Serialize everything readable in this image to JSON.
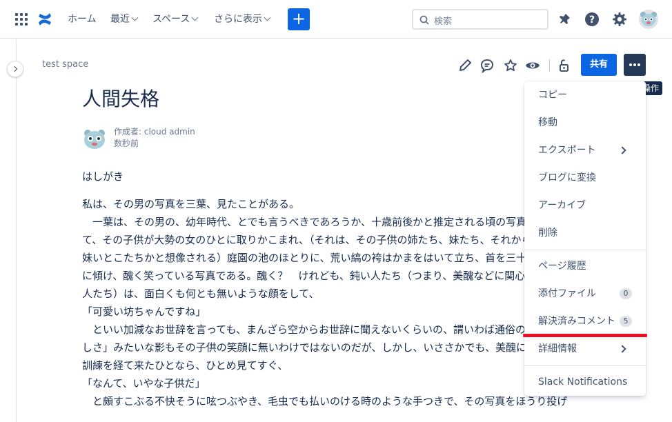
{
  "topnav": {
    "home": "ホーム",
    "recent": "最近",
    "spaces": "スペース",
    "more": "さらに表示",
    "create": "+",
    "search_placeholder": "検索"
  },
  "page": {
    "space_name": "test space",
    "share_label": "共有",
    "more_tooltip": "その他の操作",
    "title": "人間失格",
    "author": "作成者: cloud admin",
    "time_ago": "数秒前"
  },
  "content": {
    "lines": [
      "はしがき",
      "私は、その男の写真を三葉、見たことがある。",
      "　一葉は、その男の、幼年時代、とでも言うべきであろうか、十歳前後かと推定される頃の写真であっ",
      "て、その子供が大勢の女のひとに取りかこまれ、（それは、その子供の姉たち、妹たち、それから、従姉",
      "妹いとこたちかと想像される）庭園の池のほとりに、荒い縞の袴はかまをはいて立ち、首を三十度ほど左",
      "に傾け、醜く笑っている写真である。醜く？　けれども、鈍い人たち（つまり、美醜などに関心を持たぬ",
      "人たち）は、面白くも何とも無いような顔をして、",
      "「可愛い坊ちゃんですね」",
      "　といい加減なお世辞を言っても、まんざら空からお世辞に聞えないくらいの、謂いわば通俗の「可愛ら",
      "しさ」みたいな影もその子供の笑顔に無いわけではないのだが、しかし、いささかでも、美醜に就いての",
      "訓練を経て来たひとなら、ひとめ見てすぐ、",
      "「なんて、いやな子供だ」",
      "　と頗すこぶる不快そうに呟つぶやき、毛虫でも払いのける時のような手つきで、その写真をほうり投げ"
    ]
  },
  "menu": {
    "copy": "コピー",
    "move": "移動",
    "export": "エクスポート",
    "to_blog": "ブログに変換",
    "archive": "アーカイブ",
    "delete": "削除",
    "history": "ページ履歴",
    "attachments": "添付ファイル",
    "attachments_count": "0",
    "resolved_comments": "解決済みコメント",
    "resolved_count": "5",
    "details": "詳細情報",
    "slack": "Slack Notifications"
  },
  "colors": {
    "primary": "#0c66e4",
    "highlight": "#e81123"
  }
}
